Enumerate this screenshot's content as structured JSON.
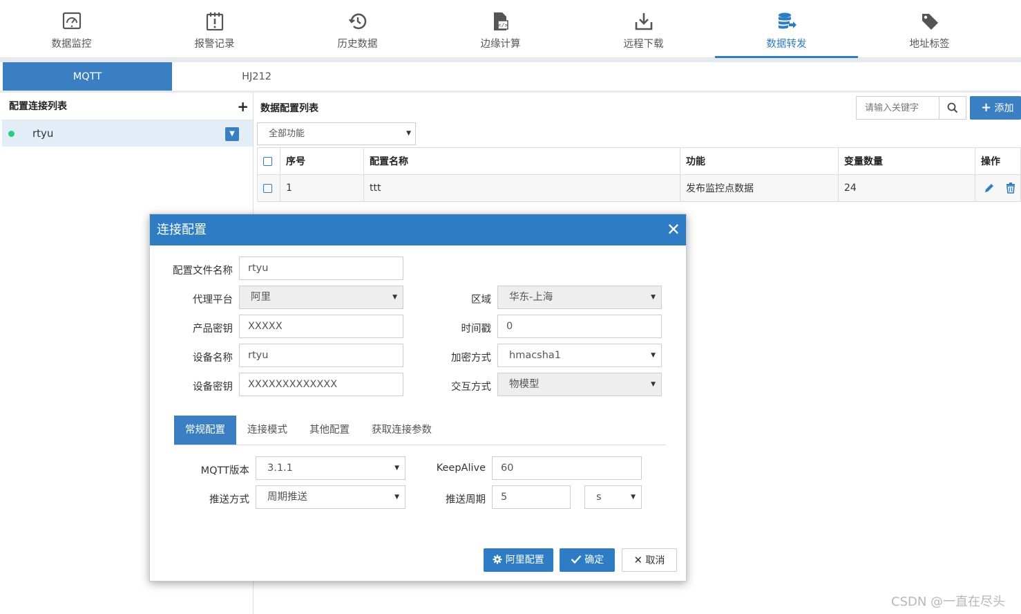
{
  "nav": {
    "items": [
      {
        "label": "数据监控",
        "icon": "monitor-icon"
      },
      {
        "label": "报警记录",
        "icon": "alarm-calendar-icon"
      },
      {
        "label": "历史数据",
        "icon": "history-icon"
      },
      {
        "label": "边缘计算",
        "icon": "code-file-icon"
      },
      {
        "label": "远程下载",
        "icon": "download-icon"
      },
      {
        "label": "数据转发",
        "icon": "database-forward-icon"
      },
      {
        "label": "地址标签",
        "icon": "tag-icon"
      }
    ],
    "active_index": 5
  },
  "subtabs": [
    "MQTT",
    "HJ212"
  ],
  "left_panel": {
    "title": "配置连接列表",
    "add_icon": "plus-icon",
    "connection": {
      "name": "rtyu",
      "status_color": "#2bcf7a"
    }
  },
  "right_panel": {
    "title": "数据配置列表",
    "search_placeholder": "请输入关键字",
    "add_label": "添加",
    "filter_value": "全部功能",
    "table": {
      "headers": [
        "序号",
        "配置名称",
        "功能",
        "变量数量",
        "操作"
      ],
      "rows": [
        {
          "index": "1",
          "name": "ttt",
          "function": "发布监控点数据",
          "var_count": "24"
        }
      ]
    }
  },
  "modal": {
    "title": "连接配置",
    "fields": {
      "config_name_label": "配置文件名称",
      "config_name_value": "rtyu",
      "proxy_label": "代理平台",
      "proxy_value": "阿里",
      "region_label": "区域",
      "region_value": "华东-上海",
      "product_key_label": "产品密钥",
      "product_key_value": "XXXXX",
      "timestamp_label": "时间戳",
      "timestamp_value": "0",
      "device_name_label": "设备名称",
      "device_name_value": "rtyu",
      "encrypt_label": "加密方式",
      "encrypt_value": "hmacsha1",
      "device_secret_label": "设备密钥",
      "device_secret_value": "XXXXXXXXXXXXX",
      "interact_label": "交互方式",
      "interact_value": "物模型"
    },
    "tabs": [
      "常规配置",
      "连接模式",
      "其他配置",
      "获取连接参数"
    ],
    "general": {
      "mqtt_version_label": "MQTT版本",
      "mqtt_version_value": "3.1.1",
      "keepalive_label": "KeepAlive",
      "keepalive_value": "60",
      "push_mode_label": "推送方式",
      "push_mode_value": "周期推送",
      "push_period_label": "推送周期",
      "push_period_value": "5",
      "push_unit_value": "s"
    },
    "buttons": {
      "ali_config": "阿里配置",
      "confirm": "确定",
      "cancel": "取消"
    }
  },
  "watermark": "CSDN @一直在尽头",
  "colors": {
    "accent": "#2d7cc4",
    "tab_active": "#3a7fc1",
    "status_online": "#2bcf7a"
  }
}
